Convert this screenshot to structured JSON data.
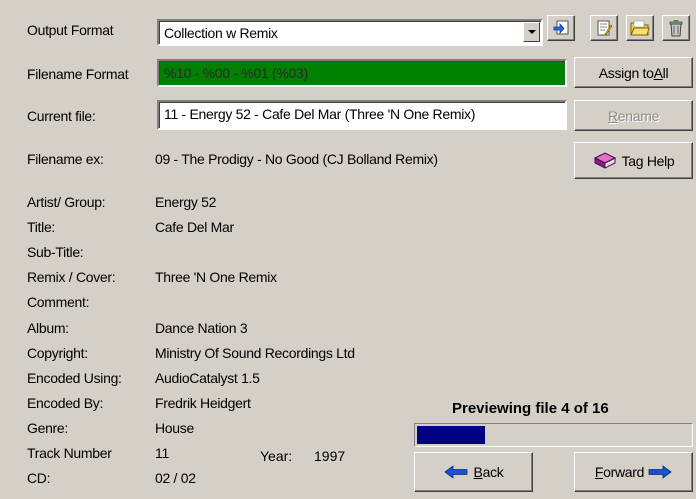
{
  "output_format": {
    "label": "Output Format",
    "selected": "Collection w Remix"
  },
  "toolbar": {
    "icons": [
      "load-icon",
      "edit-icon",
      "folder-icon",
      "delete-icon"
    ]
  },
  "filename_format": {
    "label": "Filename Format",
    "value": "%10 - %00 - %01 (%03)",
    "highlight_color": "#008000"
  },
  "assign_button": {
    "pre": "Assign to ",
    "accel": "A",
    "post": "ll"
  },
  "current_file": {
    "label": "Current file:",
    "value": "11 - Energy 52 - Cafe Del Mar (Three 'N One Remix)"
  },
  "rename_button": {
    "accel": "R",
    "post": "ename"
  },
  "filename_ex": {
    "label": "Filename ex:",
    "value": "09 - The Prodigy - No Good (CJ Bolland Remix)"
  },
  "tag_help_button": {
    "label": "Tag Help"
  },
  "tags": [
    {
      "label": "Artist/ Group:",
      "value": "Energy 52"
    },
    {
      "label": "Title:",
      "value": "Cafe Del Mar"
    },
    {
      "label": "Sub-Title:",
      "value": ""
    },
    {
      "label": "Remix / Cover:",
      "value": "Three 'N One Remix"
    },
    {
      "label": "Comment:",
      "value": ""
    },
    {
      "label": "Album:",
      "value": "Dance Nation  3"
    },
    {
      "label": "Copyright:",
      "value": "Ministry Of Sound Recordings Ltd"
    },
    {
      "label": "Encoded Using:",
      "value": "AudioCatalyst 1.5"
    },
    {
      "label": "Encoded By:",
      "value": "Fredrik Heidgert"
    },
    {
      "label": "Genre:",
      "value": "House"
    },
    {
      "label": "Track Number",
      "value": "11"
    },
    {
      "label": "CD:",
      "value": "02 / 02"
    }
  ],
  "year": {
    "label": "Year:",
    "value": "1997"
  },
  "preview": {
    "status": "Previewing file 4 of 16",
    "progress": 0.25,
    "bar_color": "#000080"
  },
  "back_button": {
    "accel": "B",
    "post": "ack"
  },
  "forward_button": {
    "accel": "F",
    "post": "orward"
  },
  "accent": {
    "arrow_color": "#1e50d2"
  }
}
